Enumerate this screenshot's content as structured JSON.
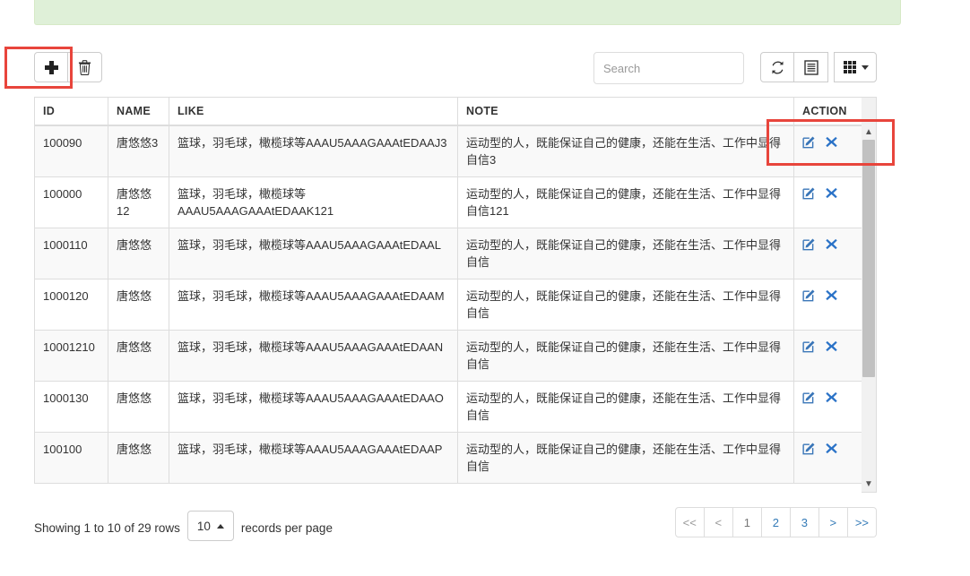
{
  "banner": {
    "text": ""
  },
  "toolbar": {
    "add_label": "+",
    "add_icon": "plus-icon",
    "delete_icon": "trash-icon",
    "refresh_icon": "refresh-icon",
    "toggle_icon": "list-toggle-icon",
    "columns_icon": "columns-grid-icon",
    "search_placeholder": "Search",
    "search_value": ""
  },
  "table": {
    "columns": [
      "ID",
      "NAME",
      "LIKE",
      "NOTE",
      "ACTION"
    ],
    "rows": [
      {
        "id": "100090",
        "name": "唐悠悠3",
        "like": "篮球，羽毛球，橄榄球等AAAU5AAAGAAAtEDAAJ3",
        "note": "运动型的人，既能保证自己的健康，还能在生活、工作中显得自信3"
      },
      {
        "id": "100000",
        "name": "唐悠悠12",
        "like": "篮球，羽毛球，橄榄球等AAAU5AAAGAAAtEDAAK121",
        "note": "运动型的人，既能保证自己的健康，还能在生活、工作中显得自信121"
      },
      {
        "id": "1000110",
        "name": "唐悠悠",
        "like": "篮球，羽毛球，橄榄球等AAAU5AAAGAAAtEDAAL",
        "note": "运动型的人，既能保证自己的健康，还能在生活、工作中显得自信"
      },
      {
        "id": "1000120",
        "name": "唐悠悠",
        "like": "篮球，羽毛球，橄榄球等AAAU5AAAGAAAtEDAAM",
        "note": "运动型的人，既能保证自己的健康，还能在生活、工作中显得自信"
      },
      {
        "id": "10001210",
        "name": "唐悠悠",
        "like": "篮球，羽毛球，橄榄球等AAAU5AAAGAAAtEDAAN",
        "note": "运动型的人，既能保证自己的健康，还能在生活、工作中显得自信"
      },
      {
        "id": "1000130",
        "name": "唐悠悠",
        "like": "篮球，羽毛球，橄榄球等AAAU5AAAGAAAtEDAAO",
        "note": "运动型的人，既能保证自己的健康，还能在生活、工作中显得自信"
      },
      {
        "id": "100100",
        "name": "唐悠悠",
        "like": "篮球，羽毛球，橄榄球等AAAU5AAAGAAAtEDAAP",
        "note": "运动型的人，既能保证自己的健康，还能在生活、工作中显得自信"
      }
    ],
    "row_action_edit_icon": "edit-icon",
    "row_action_delete_icon": "delete-x-icon"
  },
  "footer": {
    "showing_text": "Showing 1 to 10 of 29 rows",
    "page_size": "10",
    "records_per_page_label": "records per page",
    "pagination": [
      {
        "label": "<<",
        "state": "muted"
      },
      {
        "label": "<",
        "state": "muted"
      },
      {
        "label": "1",
        "state": "active"
      },
      {
        "label": "2",
        "state": "link"
      },
      {
        "label": "3",
        "state": "link"
      },
      {
        "label": ">",
        "state": "link"
      },
      {
        "label": ">>",
        "state": "link"
      }
    ]
  },
  "annotations": {
    "add_button_highlight": "red-highlight-box",
    "action_column_highlight": "red-highlight-box"
  },
  "colors": {
    "banner_bg": "#dff0d8",
    "banner_border": "#d6e9c6",
    "link": "#337ab7",
    "annotation": "#e8453c",
    "stripe": "#f9f9f9"
  }
}
